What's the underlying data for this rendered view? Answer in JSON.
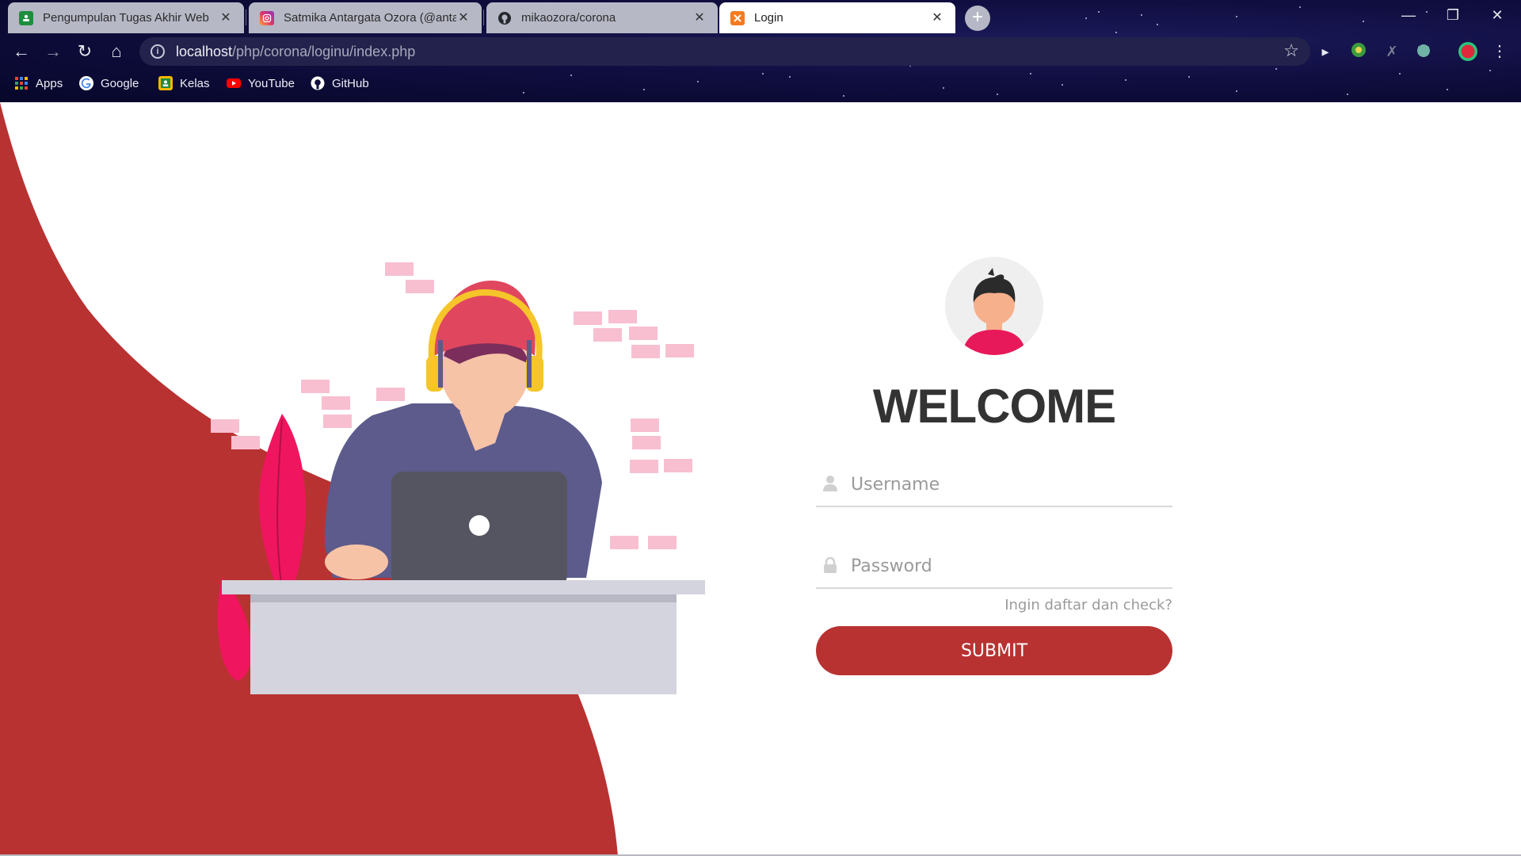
{
  "browser": {
    "tabs": [
      {
        "title": "Pengumpulan Tugas Akhir Web",
        "icon": "google-classroom-icon",
        "active": false
      },
      {
        "title": "Satmika Antargata Ozora (@anta",
        "icon": "instagram-icon",
        "active": false
      },
      {
        "title": "mikaozora/corona",
        "icon": "github-icon",
        "active": false
      },
      {
        "title": "Login",
        "icon": "xampp-icon",
        "active": true
      }
    ],
    "address": {
      "host": "localhost",
      "path": "/php/corona/loginu/index.php"
    },
    "bookmarks": [
      {
        "label": "Apps",
        "icon": "apps-grid-icon"
      },
      {
        "label": "Google",
        "icon": "google-icon"
      },
      {
        "label": "Kelas",
        "icon": "google-classroom-icon"
      },
      {
        "label": "YouTube",
        "icon": "youtube-icon"
      },
      {
        "label": "GitHub",
        "icon": "github-icon"
      }
    ]
  },
  "login": {
    "heading": "WELCOME",
    "username_placeholder": "Username",
    "password_placeholder": "Password",
    "register_link": "Ingin daftar dan check?",
    "submit_label": "SUBMIT"
  },
  "colors": {
    "accent_red": "#b83232",
    "chrome_bg": "#100e40",
    "heading": "#333333"
  }
}
